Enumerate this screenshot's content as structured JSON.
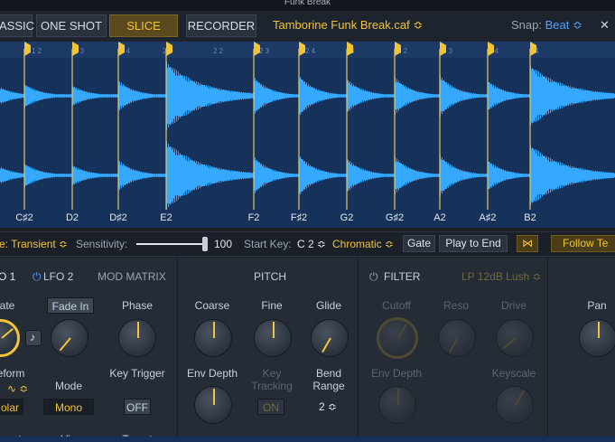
{
  "window": {
    "title": "Funk Break"
  },
  "modes": [
    {
      "label": "ASSIC",
      "active": false
    },
    {
      "label": "ONE SHOT",
      "active": false
    },
    {
      "label": "SLICE",
      "active": true
    },
    {
      "label": "RECORDER",
      "active": false
    }
  ],
  "file": {
    "name": "Tamborine Funk Break.caf ≎"
  },
  "snap": {
    "label": "Snap:",
    "value": "Beat ≎"
  },
  "ruler_marks": [
    "1 2",
    "1 3",
    "1 4",
    "2",
    "2 2",
    "2 3",
    "2 4",
    "3",
    "3 2",
    "3 3",
    "3 4",
    "4"
  ],
  "slice_notes": [
    "C♯2",
    "D2",
    "D♯2",
    "E2",
    "F2",
    "F♯2",
    "G2",
    "G♯2",
    "A2",
    "A♯2",
    "B2"
  ],
  "slice_bar": {
    "mode_label": "e: Transient ≎",
    "sensitivity_label": "Sensitivity:",
    "sensitivity_value": "100",
    "start_key_label": "Start Key:",
    "start_key_value": "C 2 ≎",
    "scale_value": "Chromatic ≎",
    "gate_label": "Gate",
    "play_label": "Play to End",
    "follow_label": "Follow Te"
  },
  "mod_tabs": {
    "lfo1": "O 1",
    "lfo2": "LFO 2",
    "matrix": "MOD MATRIX"
  },
  "mod_controls": {
    "rate": "ate",
    "fade_in": "Fade In",
    "phase": "Phase",
    "waveform": "eform",
    "waveform_value": "olar",
    "mode": "Mode",
    "mode_value": "Mono",
    "key_trigger": "Key Trigger",
    "key_trigger_value": "OFF",
    "bottom1": "ount",
    "bottom2": "Via",
    "bottom3": "Target"
  },
  "pitch": {
    "title": "PITCH",
    "coarse": "Coarse",
    "fine": "Fine",
    "glide": "Glide",
    "env_depth": "Env Depth",
    "key_tracking": "Key Tracking",
    "key_tracking_value": "ON",
    "bend_range": "Bend Range",
    "bend_range_value": "2 ≎"
  },
  "filter": {
    "title": "FILTER",
    "type": "LP 12dB Lush ≎",
    "cutoff": "Cutoff",
    "reso": "Reso",
    "drive": "Drive",
    "env_depth": "Env Depth",
    "keyscale": "Keyscale"
  },
  "amp": {
    "pan": "Pan"
  }
}
